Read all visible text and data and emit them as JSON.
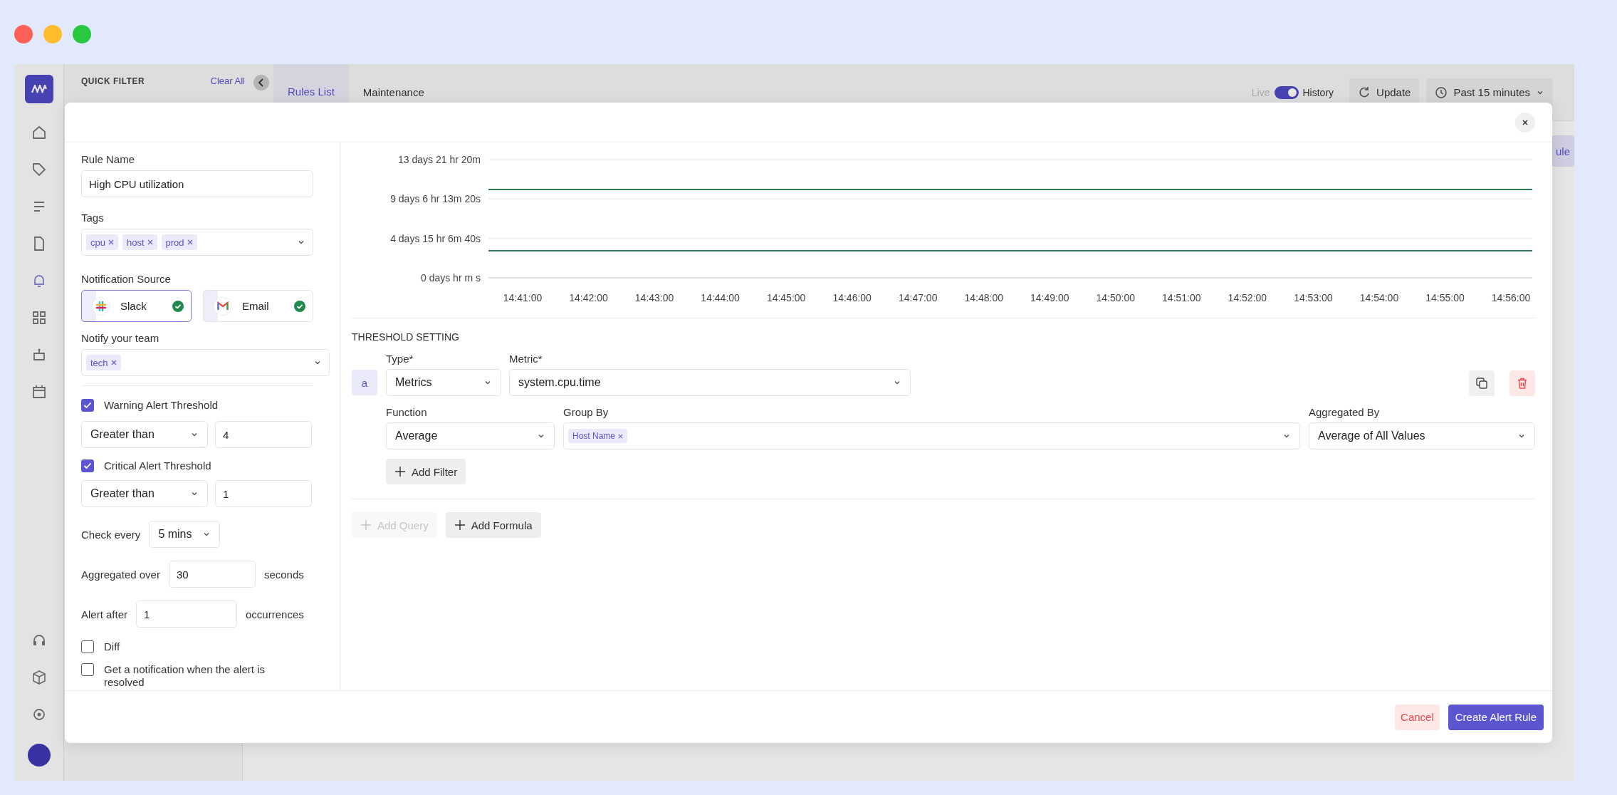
{
  "background_app": {
    "quick_filter": {
      "title": "QUICK FILTER",
      "clear": "Clear All"
    },
    "tabs": [
      {
        "label": "Rules List",
        "selected": true
      },
      {
        "label": "Maintenance",
        "selected": false
      }
    ],
    "live_toggle": {
      "left": "Live",
      "right": "History",
      "on": true
    },
    "update_button": "Update",
    "time_range": "Past 15 minutes",
    "new_rule_button": "ule"
  },
  "modal": {
    "rule_name": {
      "label": "Rule Name",
      "value": "High CPU utilization"
    },
    "tags": {
      "label": "Tags",
      "items": [
        "cpu",
        "host",
        "prod"
      ]
    },
    "notification_source": {
      "label": "Notification Source",
      "options": [
        {
          "name": "Slack",
          "kind": "slack",
          "selected": true,
          "connected": true
        },
        {
          "name": "Email",
          "kind": "email",
          "selected": false,
          "connected": true
        }
      ]
    },
    "notify_team": {
      "label": "Notify your team",
      "items": [
        "tech"
      ]
    },
    "thresholds": [
      {
        "label": "Warning Alert Threshold",
        "checked": true,
        "operator": "Greater than",
        "value": "4"
      },
      {
        "label": "Critical Alert Threshold",
        "checked": true,
        "operator": "Greater than",
        "value": "1"
      }
    ],
    "check_every": {
      "label": "Check every",
      "value": "5 mins"
    },
    "aggregated_over": {
      "label": "Aggregated over",
      "value": "30",
      "unit": "seconds"
    },
    "alert_after": {
      "label": "Alert after",
      "value": "1",
      "unit": "occurrences"
    },
    "options": [
      {
        "label": "Diff",
        "checked": false
      },
      {
        "label": "Get a notification when the alert is resolved",
        "checked": false
      }
    ],
    "chart": {
      "x_axis_labels": [
        "14:41:00",
        "14:42:00",
        "14:43:00",
        "14:44:00",
        "14:45:00",
        "14:46:00",
        "14:47:00",
        "14:48:00",
        "14:49:00",
        "14:50:00",
        "14:51:00",
        "14:52:00",
        "14:53:00",
        "14:54:00",
        "14:55:00",
        "14:56:00"
      ],
      "y_axis_labels": [
        "13 days 21 hr 20m",
        "9 days 6 hr 13m 20s",
        "4 days 15 hr 6m 40s",
        "0 days hr m s"
      ]
    },
    "threshold_setting": {
      "title": "THRESHOLD SETTING",
      "query": {
        "letter": "a",
        "type_label": "Type*",
        "type": "Metrics",
        "metric_label": "Metric*",
        "metric": "system.cpu.time",
        "function_label": "Function",
        "function": "Average",
        "group_by_label": "Group By",
        "group_by": [
          "Host Name"
        ],
        "aggregated_by_label": "Aggregated By",
        "aggregated_by": "Average of All Values",
        "add_filter": "Add Filter"
      },
      "add_query": {
        "label": "Add Query",
        "disabled": true
      },
      "add_formula": {
        "label": "Add Formula",
        "disabled": false
      }
    },
    "footer": {
      "cancel": "Cancel",
      "submit": "Create Alert Rule"
    }
  }
}
